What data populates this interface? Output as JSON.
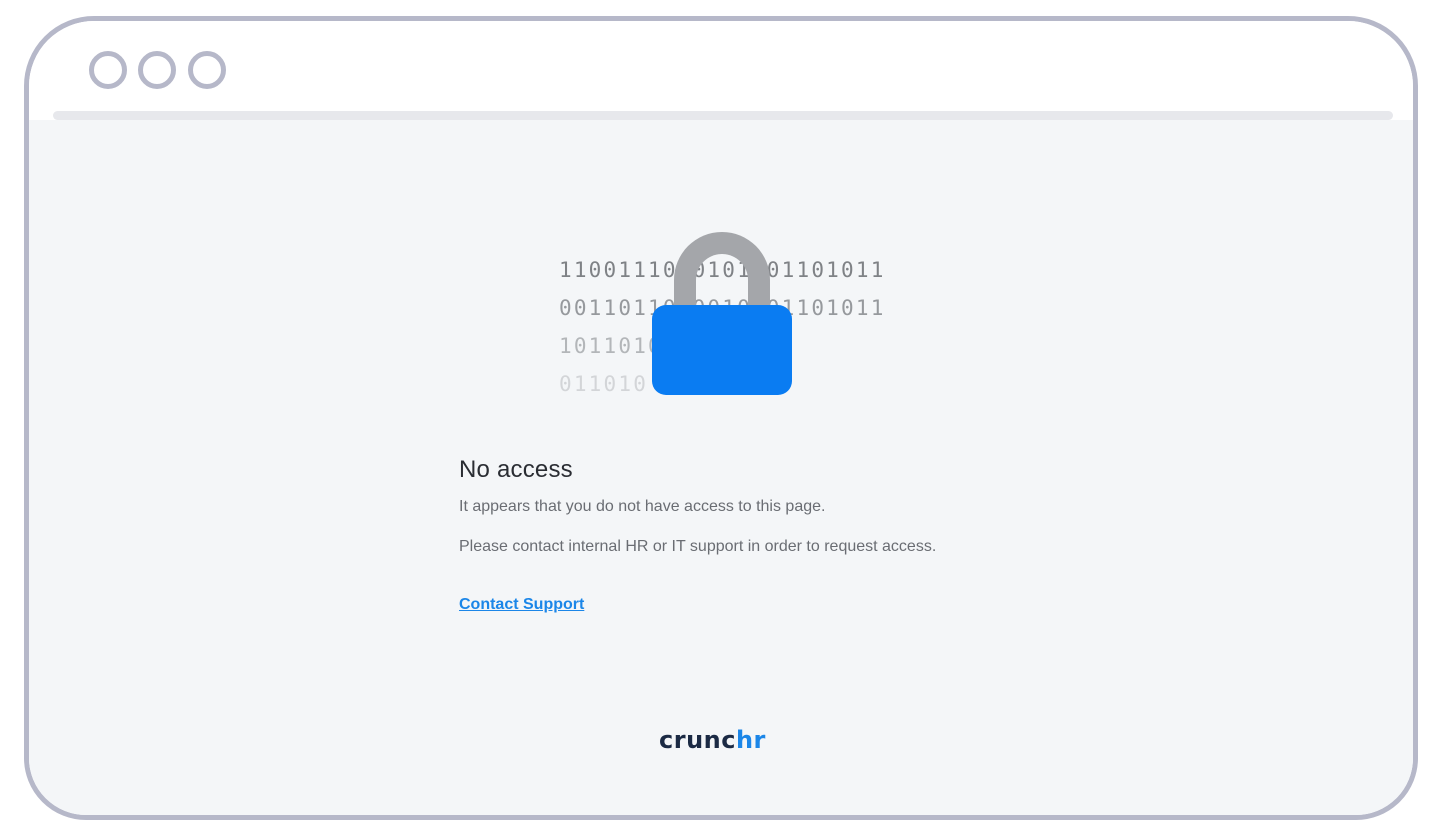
{
  "window": {
    "controls": [
      "window-dot",
      "window-dot",
      "window-dot"
    ]
  },
  "illustration": {
    "binary_rows": [
      "11001110 0101 01101011",
      "00110110 0010 01101011",
      "1011010          011010",
      "011010           101010"
    ],
    "lock_color": "#0a7cf2",
    "shackle_color": "#a4a6aa"
  },
  "message": {
    "title": "No access",
    "line1": "It appears that you do not have access to this page.",
    "line2": "Please contact internal HR or IT support in order to request access.",
    "link_label": "Contact Support"
  },
  "brand": {
    "part_dark": "crunc",
    "part_blue": "hr",
    "dark_color": "#1b2a44",
    "blue_color": "#1b86e8"
  },
  "colors": {
    "accent": "#1b86e8",
    "background": "#f4f6f8",
    "frame": "#b6b8c9"
  }
}
